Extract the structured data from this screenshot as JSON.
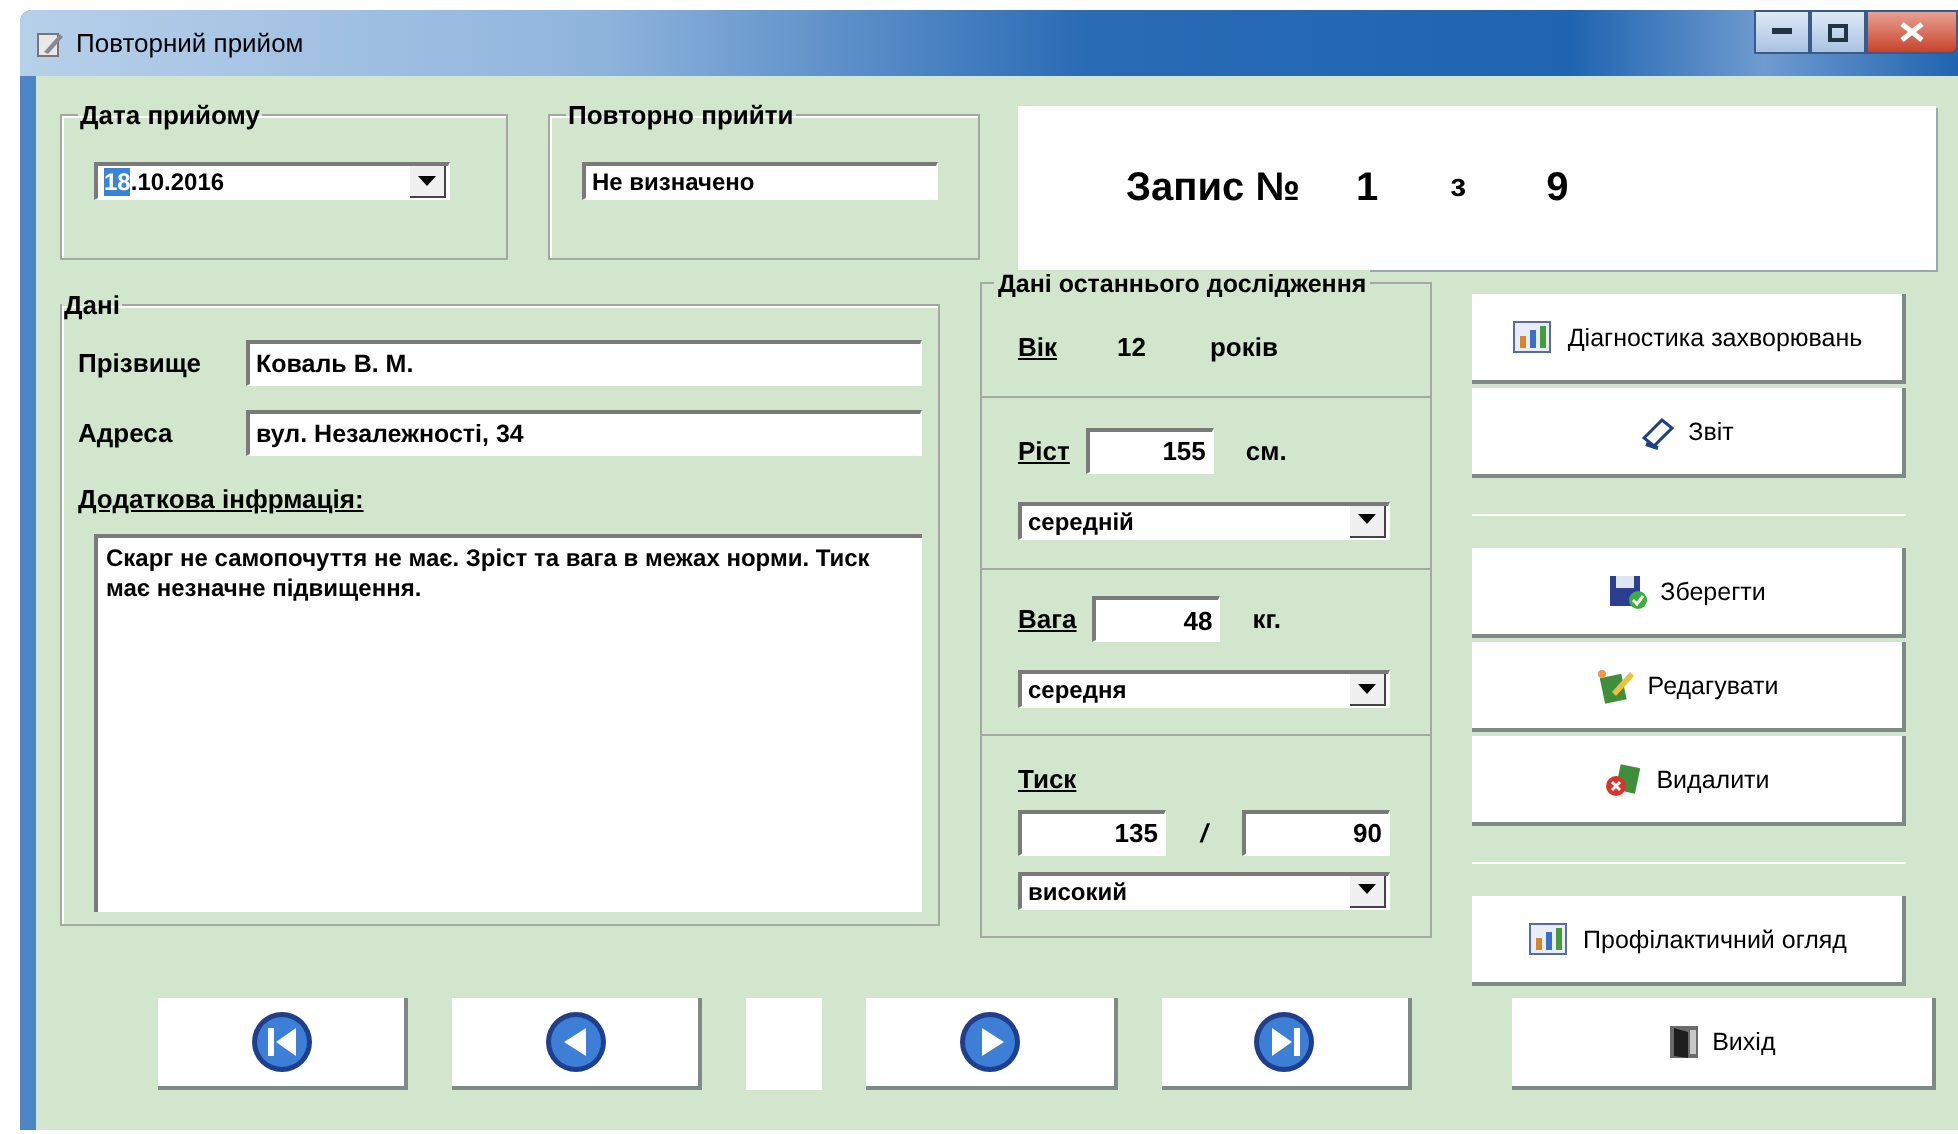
{
  "window": {
    "title": "Повторний прийом"
  },
  "date_group": {
    "title": "Дата прийому",
    "date_parts": [
      {
        "text": "18",
        "selected": true
      },
      {
        "text": ".10.2016",
        "selected": false
      }
    ]
  },
  "return_group": {
    "title": "Повторно прийти",
    "value": "Не визначено"
  },
  "record": {
    "label": "Запис №",
    "number": "1",
    "of": "з",
    "total": "9"
  },
  "data_group": {
    "title": "Дані",
    "fields": [
      {
        "label": "Прізвище",
        "value": "Коваль В. М."
      },
      {
        "label": "Адреса",
        "value": "вул. Незалежності, 34"
      }
    ],
    "notes_label": "Додаткова інфрмація:",
    "notes": "Скарг не самопочуття не має. Зріст та вага в межах норми. Тиск має незначне підвищення."
  },
  "exam_group": {
    "title": "Дані останнього дослідження",
    "age": {
      "label": "Вік",
      "value": "12",
      "unit": "років"
    },
    "height": {
      "label": "Ріст",
      "value": "155",
      "unit": "см.",
      "category": "середній"
    },
    "weight": {
      "label": "Вага",
      "value": "48",
      "unit": "кг.",
      "category": "середня"
    },
    "pressure": {
      "label": "Тиск",
      "systolic": "135",
      "separator": "/",
      "diastolic": "90",
      "category": "високий"
    }
  },
  "action_groups": [
    [
      {
        "label": "Діагностика захворювань",
        "kind": "chart"
      },
      {
        "label": "Звіт",
        "kind": "report"
      }
    ],
    [
      {
        "label": "Зберегти",
        "kind": "save"
      },
      {
        "label": "Редагувати",
        "kind": "edit"
      },
      {
        "label": "Видалити",
        "kind": "delete"
      }
    ],
    [
      {
        "label": "Профілактичний огляд",
        "kind": "chart"
      }
    ]
  ],
  "nav": [
    {
      "kind": "first"
    },
    {
      "kind": "prev"
    },
    {
      "kind": "field"
    },
    {
      "kind": "next"
    },
    {
      "kind": "last"
    }
  ],
  "exit_button": {
    "label": "Вихід",
    "kind": "exit"
  }
}
